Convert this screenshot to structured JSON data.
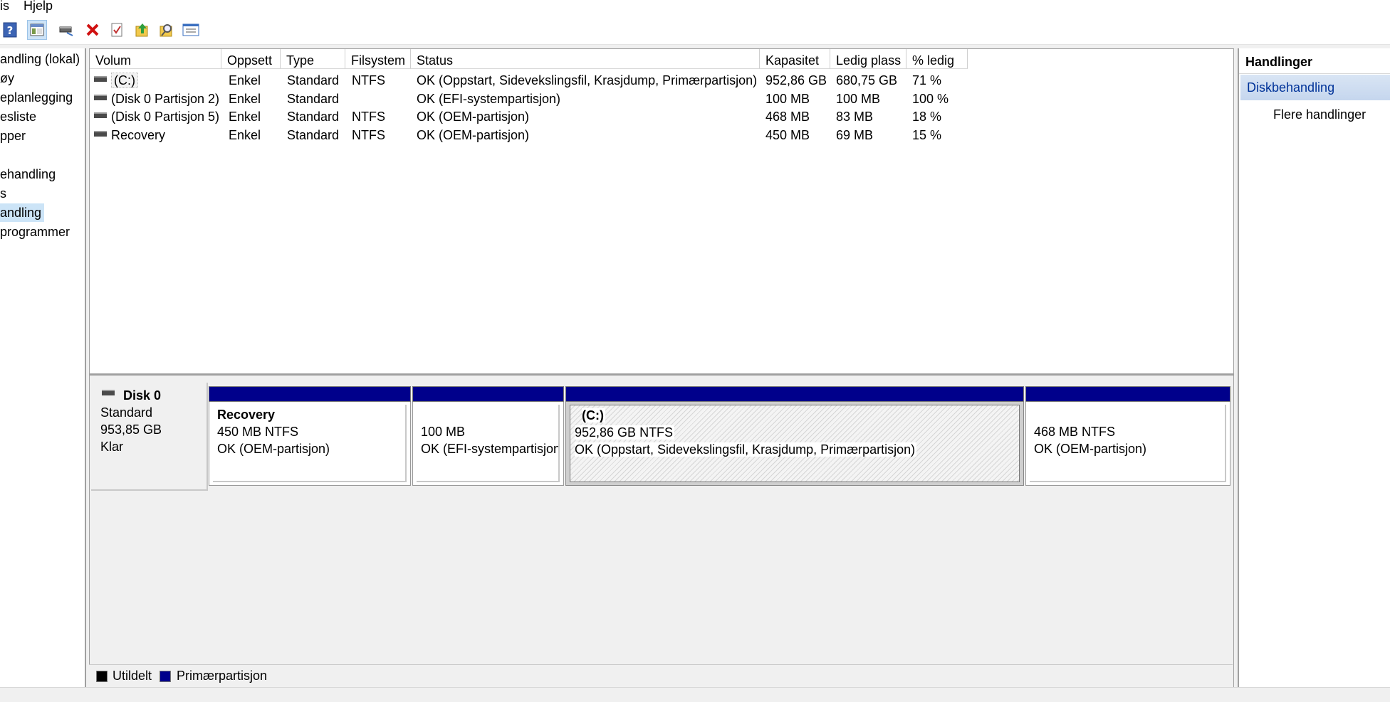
{
  "menu": {
    "items": [
      "is",
      "Hjelp"
    ]
  },
  "toolbar": {
    "icons": [
      "help-icon",
      "show-hide-console-tree-icon",
      "connect-disk-icon",
      "delete-icon",
      "check-icon",
      "export-icon",
      "search-icon",
      "properties-icon"
    ]
  },
  "nav": {
    "items": [
      "andling (lokal)",
      "øy",
      "eplanlegging",
      "esliste",
      "pper",
      "ehandling",
      "s",
      "andling",
      " programmer"
    ],
    "selected_index": 7
  },
  "volumes": {
    "columns": [
      "Volum",
      "Oppsett",
      "Type",
      "Filsystem",
      "Status",
      "Kapasitet",
      "Ledig plass",
      "% ledig"
    ],
    "rows": [
      {
        "volum": "(C:)",
        "oppsett": "Enkel",
        "type": "Standard",
        "filsystem": "NTFS",
        "status": "OK (Oppstart, Sidevekslingsfil, Krasjdump, Primærpartisjon)",
        "kapasitet": "952,86 GB",
        "ledig": "680,75 GB",
        "pct": "71 %"
      },
      {
        "volum": "(Disk 0 Partisjon 2)",
        "oppsett": "Enkel",
        "type": "Standard",
        "filsystem": "",
        "status": "OK (EFI-systempartisjon)",
        "kapasitet": "100 MB",
        "ledig": "100 MB",
        "pct": "100 %"
      },
      {
        "volum": "(Disk 0 Partisjon 5)",
        "oppsett": "Enkel",
        "type": "Standard",
        "filsystem": "NTFS",
        "status": "OK (OEM-partisjon)",
        "kapasitet": "468 MB",
        "ledig": "83 MB",
        "pct": "18 %"
      },
      {
        "volum": "Recovery",
        "oppsett": "Enkel",
        "type": "Standard",
        "filsystem": "NTFS",
        "status": "OK (OEM-partisjon)",
        "kapasitet": "450 MB",
        "ledig": "69 MB",
        "pct": "15 %"
      }
    ]
  },
  "disk": {
    "name": "Disk 0",
    "type": "Standard",
    "size": "953,85 GB",
    "state": "Klar",
    "partitions": [
      {
        "title": "Recovery",
        "size": "450 MB NTFS",
        "status": "OK (OEM-partisjon)"
      },
      {
        "title": "",
        "size": "100 MB",
        "status": "OK (EFI-systempartisjon)"
      },
      {
        "title": "(C:)",
        "size": "952,86 GB NTFS",
        "status": "OK (Oppstart, Sidevekslingsfil, Krasjdump, Primærpartisjon)"
      },
      {
        "title": "",
        "size": "468 MB NTFS",
        "status": "OK (OEM-partisjon)"
      }
    ]
  },
  "legend": {
    "items": [
      {
        "label": "Utildelt",
        "color": "#000000"
      },
      {
        "label": "Primærpartisjon",
        "color": "#00008b"
      }
    ]
  },
  "actions": {
    "title": "Handlinger",
    "section": "Diskbehandling",
    "more": "Flere handlinger"
  }
}
